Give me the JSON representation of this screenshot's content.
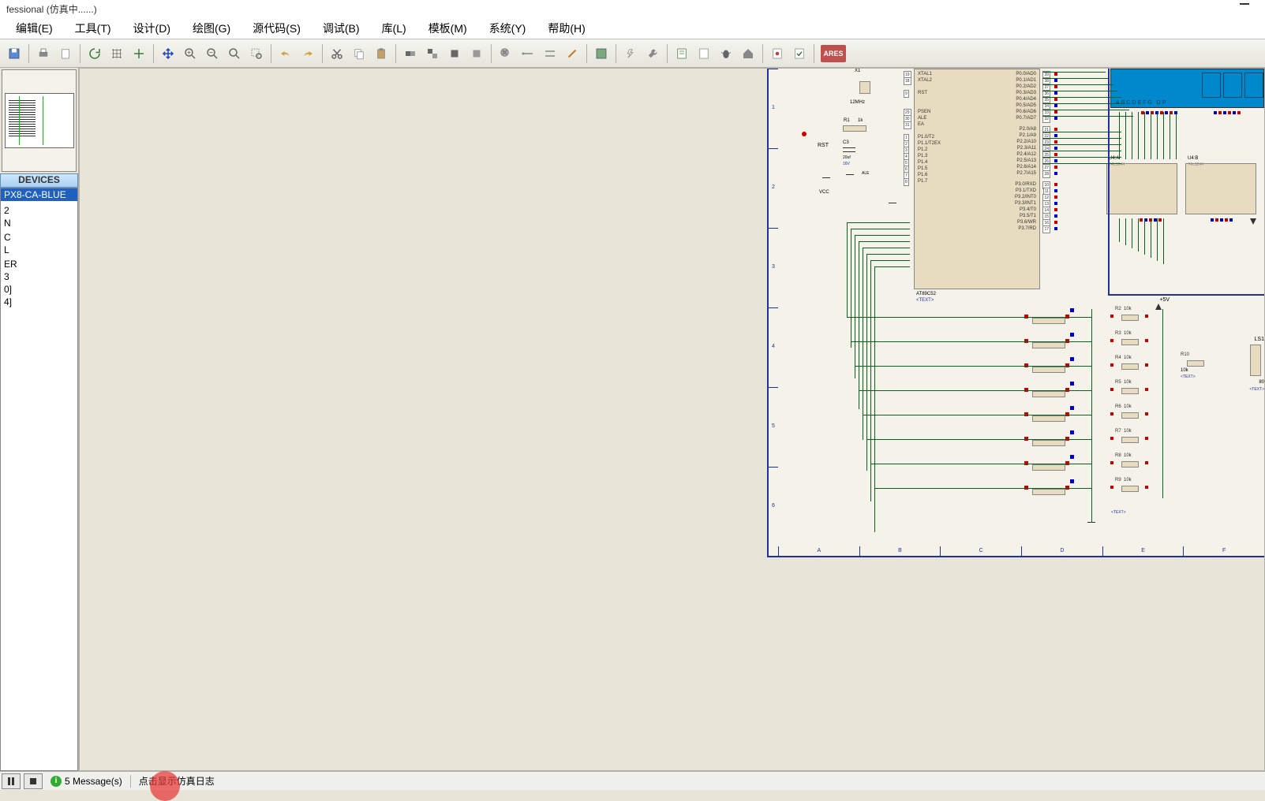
{
  "title": "fessional (仿真中......)",
  "menu": {
    "edit": "编辑(E)",
    "tools": "工具(T)",
    "design": "设计(D)",
    "draw": "绘图(G)",
    "source": "源代码(S)",
    "debug": "调试(B)",
    "library": "库(L)",
    "template": "模板(M)",
    "system": "系统(Y)",
    "help": "帮助(H)"
  },
  "toolbar": {
    "ares": "ARES"
  },
  "devices_header": "DEVICES",
  "devices": [
    "PX8-CA-BLUE",
    "",
    "",
    "2",
    "N",
    "",
    "C",
    "L",
    "",
    "ER",
    "3",
    "0]",
    "4]"
  ],
  "schematic": {
    "ruler_rows": [
      "1",
      "2",
      "3",
      "4",
      "5",
      "6"
    ],
    "ruler_cols": [
      "A",
      "B",
      "C",
      "D",
      "E",
      "F"
    ],
    "mcu": {
      "ref": "AT89C52",
      "left_pins": [
        {
          "num": "19",
          "name": "XTAL1"
        },
        {
          "num": "18",
          "name": "XTAL2"
        },
        {
          "num": "9",
          "name": "RST"
        },
        {
          "num": "29",
          "name": "PSEN"
        },
        {
          "num": "30",
          "name": "ALE"
        },
        {
          "num": "31",
          "name": "EA"
        },
        {
          "num": "1",
          "name": "P1.0/T2"
        },
        {
          "num": "2",
          "name": "P1.1/T2EX"
        },
        {
          "num": "3",
          "name": "P1.2"
        },
        {
          "num": "4",
          "name": "P1.3"
        },
        {
          "num": "5",
          "name": "P1.4"
        },
        {
          "num": "6",
          "name": "P1.5"
        },
        {
          "num": "7",
          "name": "P1.6"
        },
        {
          "num": "8",
          "name": "P1.7"
        }
      ],
      "right_pins": [
        {
          "name": "P0.0/AD0",
          "num": "39"
        },
        {
          "name": "P0.1/AD1",
          "num": "38"
        },
        {
          "name": "P0.2/AD2",
          "num": "37"
        },
        {
          "name": "P0.3/AD3",
          "num": "36"
        },
        {
          "name": "P0.4/AD4",
          "num": "35"
        },
        {
          "name": "P0.5/AD5",
          "num": "34"
        },
        {
          "name": "P0.6/AD6",
          "num": "33"
        },
        {
          "name": "P0.7/AD7",
          "num": "32"
        },
        {
          "name": "P2.0/A8",
          "num": "21"
        },
        {
          "name": "P2.1/A9",
          "num": "22"
        },
        {
          "name": "P2.2/A10",
          "num": "23"
        },
        {
          "name": "P2.3/A11",
          "num": "24"
        },
        {
          "name": "P2.4/A12",
          "num": "25"
        },
        {
          "name": "P2.5/A13",
          "num": "26"
        },
        {
          "name": "P2.6/A14",
          "num": "27"
        },
        {
          "name": "P2.7/A15",
          "num": "28"
        },
        {
          "name": "P3.0/RXD",
          "num": "10"
        },
        {
          "name": "P3.1/TXD",
          "num": "11"
        },
        {
          "name": "P3.2/INT0",
          "num": "12"
        },
        {
          "name": "P3.3/INT1",
          "num": "13"
        },
        {
          "name": "P3.4/T0",
          "num": "14"
        },
        {
          "name": "P3.5/T1",
          "num": "15"
        },
        {
          "name": "P3.6/WR",
          "num": "16"
        },
        {
          "name": "P3.7/RD",
          "num": "17"
        }
      ]
    },
    "xtal": {
      "ref": "X1",
      "freq": "12MHz"
    },
    "reset": {
      "r": "R1",
      "rval": "1k",
      "c": "C3",
      "cval": "20uf",
      "cv": "16V",
      "label": "RST",
      "vcc": "VCC"
    },
    "led_label": "ABCDEFG DP",
    "buffers": [
      {
        "ref": "U4:A",
        "part": "74LS244"
      },
      {
        "ref": "U4:B",
        "part": "74LS244"
      }
    ],
    "vcc5": "+5V",
    "resistors": [
      {
        "ref": "R2",
        "val": "10k"
      },
      {
        "ref": "R3",
        "val": "10k"
      },
      {
        "ref": "R4",
        "val": "10k"
      },
      {
        "ref": "R5",
        "val": "10k"
      },
      {
        "ref": "R6",
        "val": "10k"
      },
      {
        "ref": "R7",
        "val": "10k"
      },
      {
        "ref": "R8",
        "val": "10k"
      },
      {
        "ref": "R9",
        "val": "10k"
      }
    ],
    "r10": {
      "ref": "R10",
      "val": "10k"
    },
    "ls1": "LS1",
    "ls1_val": "80",
    "text_placeholder": "<TEXT>"
  },
  "status": {
    "messages": "5 Message(s)",
    "log_hint": "点击显示仿真日志"
  }
}
